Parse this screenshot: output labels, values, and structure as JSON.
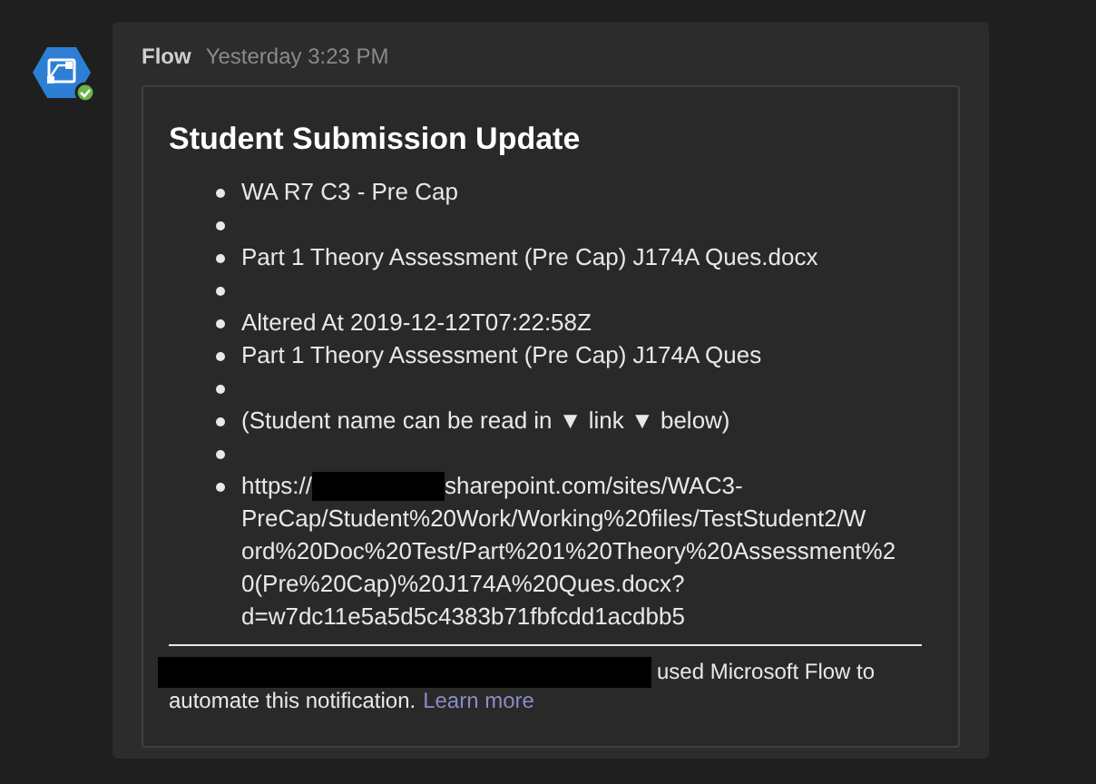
{
  "message": {
    "sender": "Flow",
    "time": "Yesterday 3:23 PM"
  },
  "card": {
    "title": "Student Submission Update",
    "items": [
      {
        "kind": "text",
        "text": "WA R7 C3 - Pre Cap"
      },
      {
        "kind": "blank"
      },
      {
        "kind": "text",
        "text": "Part 1 Theory Assessment (Pre Cap) J174A Ques.docx"
      },
      {
        "kind": "blank"
      },
      {
        "kind": "text",
        "text": "Altered At 2019-12-12T07:22:58Z"
      },
      {
        "kind": "text",
        "text": "Part 1 Theory Assessment (Pre Cap) J174A Ques"
      },
      {
        "kind": "blank"
      },
      {
        "kind": "text",
        "text": "(Student name can be read in ▼ link ▼ below)"
      },
      {
        "kind": "blank"
      },
      {
        "kind": "link",
        "prefix": "https://",
        "redacted": true,
        "lines": [
          "sharepoint.com/sites/WAC3-",
          "PreCap/Student%20Work/Working%20files/TestStudent2/W",
          "ord%20Doc%20Test/Part%201%20Theory%20Assessment%2",
          "0(Pre%20Cap)%20J174A%20Ques.docx?",
          "d=w7dc11e5a5d5c4383b71fbfcdd1acdbb5"
        ]
      }
    ],
    "footer": {
      "redacted": true,
      "text": "used Microsoft Flow to",
      "text_2": "automate this notification.",
      "link": "Learn more"
    }
  }
}
